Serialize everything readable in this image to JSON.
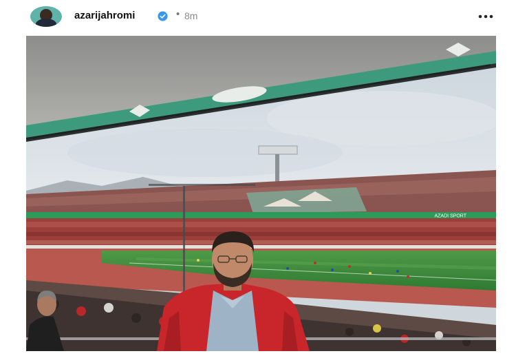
{
  "post": {
    "username": "azarijahromi",
    "separator": "•",
    "timestamp": "8m"
  },
  "icons": {
    "verified": "verified-badge-icon",
    "more": "more-options-icon"
  },
  "photo": {
    "banner_text": "AZADI SPORT"
  },
  "colors": {
    "verified_blue": "#3797f0",
    "pitch_green": "#3c8a3c",
    "jacket_red": "#c8262a"
  }
}
